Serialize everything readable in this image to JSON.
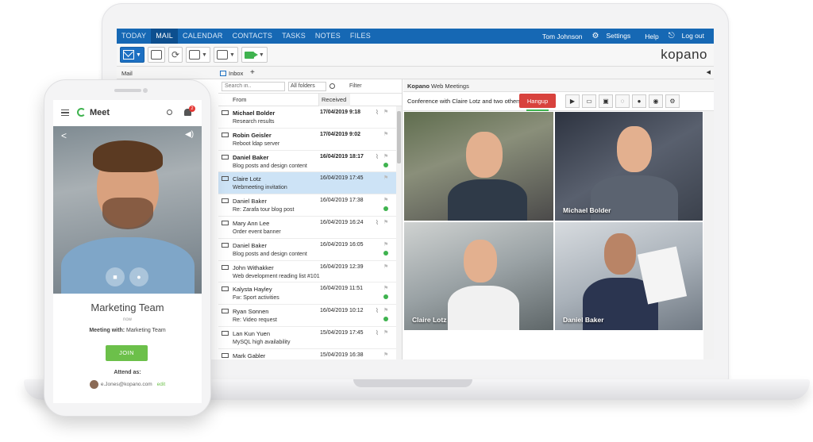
{
  "app": {
    "nav": {
      "tabs": [
        "TODAY",
        "MAIL",
        "CALENDAR",
        "CONTACTS",
        "TASKS",
        "NOTES",
        "FILES"
      ],
      "active": "MAIL",
      "user": "Tom Johnson",
      "settings": "Settings",
      "help": "Help",
      "logout": "Log out"
    },
    "brand": "kopano",
    "subbar": {
      "mail_label": "Mail",
      "inbox_tab": "Inbox"
    },
    "list": {
      "search_placeholder": "Search in..",
      "folder_select": "All folders",
      "filter": "Filter",
      "col_from": "From",
      "col_received": "Received"
    },
    "messages": [
      {
        "sender": "Michael Bolder",
        "subject": "Research results",
        "date": "17/04/2019 9:18",
        "unread": true,
        "attachment": true,
        "online": false
      },
      {
        "sender": "Robin Geisler",
        "subject": "Reboot ldap server",
        "date": "17/04/2019 9:02",
        "unread": true,
        "attachment": false,
        "online": false
      },
      {
        "sender": "Daniel Baker",
        "subject": "Blog posts and design content",
        "date": "16/04/2019 18:17",
        "unread": true,
        "attachment": true,
        "online": true
      },
      {
        "sender": "Claire Lotz",
        "subject": "Webmeeting invitation",
        "date": "16/04/2019 17:45",
        "unread": false,
        "attachment": false,
        "online": false,
        "selected": true
      },
      {
        "sender": "Daniel Baker",
        "subject": "Re: Zarafa tour blog post",
        "date": "16/04/2019 17:38",
        "unread": false,
        "attachment": false,
        "online": true
      },
      {
        "sender": "Mary Ann Lee",
        "subject": "Order event banner",
        "date": "16/04/2019 16:24",
        "unread": false,
        "attachment": true,
        "online": false
      },
      {
        "sender": "Daniel Baker",
        "subject": "Blog posts and design content",
        "date": "16/04/2019 16:05",
        "unread": false,
        "attachment": false,
        "online": true
      },
      {
        "sender": "John Withakker",
        "subject": "Web development reading list #101",
        "date": "16/04/2019 12:39",
        "unread": false,
        "attachment": false,
        "online": false
      },
      {
        "sender": "Kalysta Hayley",
        "subject": "Fw: Sport activities",
        "date": "16/04/2019 11:51",
        "unread": false,
        "attachment": false,
        "online": true
      },
      {
        "sender": "Ryan Sonnen",
        "subject": "Re: Video request",
        "date": "16/04/2019 10:12",
        "unread": false,
        "attachment": true,
        "online": true
      },
      {
        "sender": "Lan Kun Yuen",
        "subject": "MySQL high availability",
        "date": "15/04/2019 17:45",
        "unread": false,
        "attachment": true,
        "online": false
      },
      {
        "sender": "Mark Gabler",
        "subject": "",
        "date": "15/04/2019 16:38",
        "unread": false,
        "attachment": false,
        "online": false
      }
    ],
    "meeting": {
      "panel_title_bold": "Kopano",
      "panel_title": "Web Meetings",
      "conference_text": "Conference with Claire Lotz and two others",
      "hangup": "Hangup",
      "participants": [
        "",
        "Michael Bolder",
        "Claire Lotz",
        "Daniel Baker"
      ]
    }
  },
  "phone": {
    "title": "Meet",
    "notification_count": "2",
    "meeting_name": "Marketing Team",
    "time": "now",
    "with_label": "Meeting with:",
    "with_value": "Marketing Team",
    "join": "JOIN",
    "attend_as": "Attend as:",
    "email": "e.Jones@kopano.com",
    "edit": "edit"
  }
}
